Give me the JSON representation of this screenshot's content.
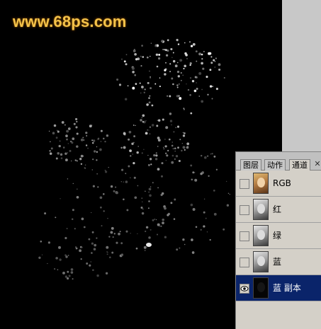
{
  "watermark": "www.68ps.com",
  "panel": {
    "tabs": [
      {
        "label": "图层"
      },
      {
        "label": "动作"
      },
      {
        "label": "通道"
      }
    ],
    "active_tab": "通道",
    "close_icon": "close-icon"
  },
  "channels": [
    {
      "label": "RGB",
      "thumbnail": "color",
      "visible": false,
      "selected": false
    },
    {
      "label": "红",
      "thumbnail": "gray",
      "visible": false,
      "selected": false
    },
    {
      "label": "绿",
      "thumbnail": "gray",
      "visible": false,
      "selected": false
    },
    {
      "label": "蓝",
      "thumbnail": "gray",
      "visible": false,
      "selected": false
    },
    {
      "label": "蓝 副本",
      "thumbnail": "dark",
      "visible": true,
      "selected": true
    }
  ],
  "colors": {
    "watermark": "#f4c24a",
    "selection": "#0a246a",
    "panel_bg": "#d4d0c8"
  }
}
